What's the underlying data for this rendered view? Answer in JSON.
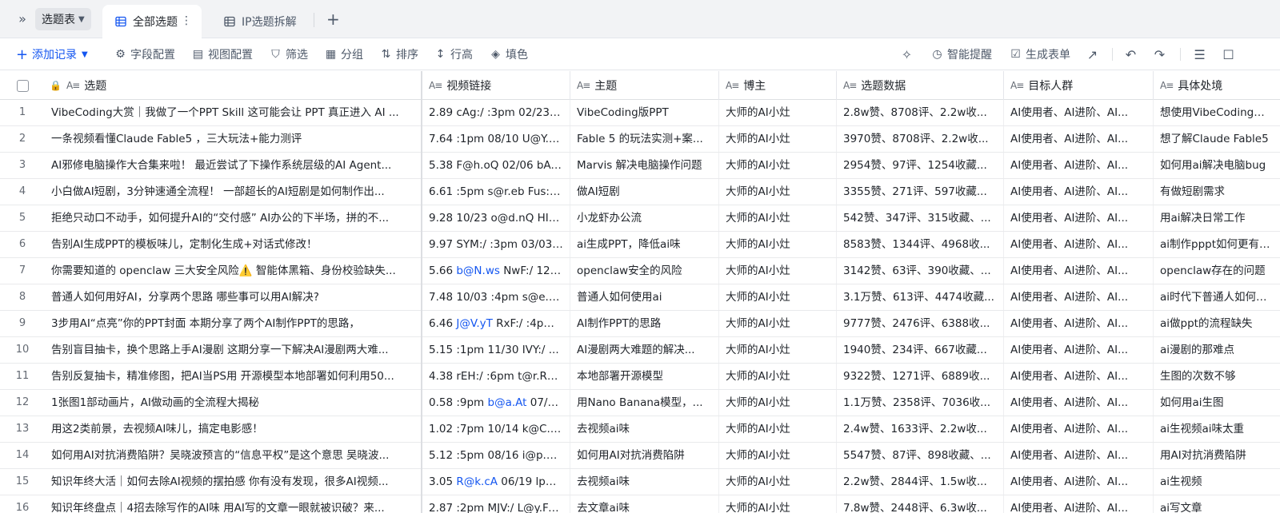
{
  "tabbar": {
    "table_name": "选题表",
    "tabs": [
      {
        "label": "全部选题",
        "active": true
      },
      {
        "label": "IP选题拆解",
        "active": false
      }
    ]
  },
  "toolbar": {
    "add_record": "添加记录",
    "field_config": "字段配置",
    "view_config": "视图配置",
    "filter": "筛选",
    "group": "分组",
    "sort": "排序",
    "row_height": "行高",
    "fill": "填色",
    "smart_remind": "智能提醒",
    "generate_form": "生成表单"
  },
  "columns": [
    "选题",
    "视频链接",
    "主题",
    "博主",
    "选题数据",
    "目标人群",
    "具体处境"
  ],
  "rows": [
    {
      "n": "1",
      "topic": "VibeCoding大赏｜我做了一个PPT Skill 这可能会让 PPT 真正进入 AI ...",
      "link_pre": "2.89 cAg:/ :3pm 02/23 ...",
      "link_hl": "",
      "link_post": "",
      "theme": "VibeCoding版PPT",
      "blogger": "大师的AI小灶",
      "stats": "2.8w赞、8708评、2.2w收...",
      "audience": "AI使用者、AI进阶、AI...",
      "situation": "想使用VibeCoding做一..."
    },
    {
      "n": "2",
      "topic": "一条视频看懂Claude Fable5 ，三大玩法+能力测评",
      "link_pre": "7.64 :1pm 08/10 U@Y.zt...",
      "link_hl": "",
      "link_post": "",
      "theme": "Fable 5 的玩法实测+案...",
      "blogger": "大师的AI小灶",
      "stats": "3970赞、8708评、2.2w收...",
      "audience": "AI使用者、AI进阶、AI...",
      "situation": "想了解Claude Fable5"
    },
    {
      "n": "3",
      "topic": "AI邪修电脑操作大合集来啦！ 最近尝试了下操作系统层级的AI Agent...",
      "link_pre": "5.38 F@h.oQ 02/06 bAt...",
      "link_hl": "",
      "link_post": "",
      "theme": "Marvis 解决电脑操作问题",
      "blogger": "大师的AI小灶",
      "stats": "2954赞、97评、1254收藏...",
      "audience": "AI使用者、AI进阶、AI...",
      "situation": "如何用ai解决电脑bug"
    },
    {
      "n": "4",
      "topic": "小白做AI短剧，3分钟速通全流程！ 一部超长的AI短剧是如何制作出...",
      "link_pre": "6.61 :5pm s@r.eb Fus:/ ...",
      "link_hl": "",
      "link_post": "",
      "theme": "做AI短剧",
      "blogger": "大师的AI小灶",
      "stats": "3355赞、271评、597收藏...",
      "audience": "AI使用者、AI进阶、AI...",
      "situation": "有做短剧需求"
    },
    {
      "n": "5",
      "topic": "拒绝只动口不动手，如何提升AI的“交付感” AI办公的下半场，拼的不...",
      "link_pre": "9.28 10/23 o@d.nQ HIv...",
      "link_hl": "",
      "link_post": "",
      "theme": "小龙虾办公流",
      "blogger": "大师的AI小灶",
      "stats": "542赞、347评、315收藏、...",
      "audience": "AI使用者、AI进阶、AI...",
      "situation": "用ai解决日常工作"
    },
    {
      "n": "6",
      "topic": "告别AI生成PPT的模板味儿，定制化生成+对话式修改！",
      "link_pre": "9.97 SYM:/ :3pm 03/03 ...",
      "link_hl": "",
      "link_post": "",
      "theme": "ai生成PPT，降低ai味",
      "blogger": "大师的AI小灶",
      "stats": "8583赞、1344评、4968收...",
      "audience": "AI使用者、AI进阶、AI...",
      "situation": "ai制作pppt如何更有“人味”"
    },
    {
      "n": "7",
      "topic": "你需要知道的 openclaw 三大安全风险⚠️ 智能体黑箱、身份校验缺失...",
      "link_pre": "5.66 ",
      "link_hl": "b@N.ws",
      "link_post": " NwF:/ 12/...",
      "theme": "openclaw安全的风险",
      "blogger": "大师的AI小灶",
      "stats": "3142赞、63评、390收藏、...",
      "audience": "AI使用者、AI进阶、AI...",
      "situation": "openclaw存在的问题"
    },
    {
      "n": "8",
      "topic": "普通人如何用好AI，分享两个思路 哪些事可以用AI解决?",
      "link_pre": "7.48 10/03 :4pm s@e.O...",
      "link_hl": "",
      "link_post": "",
      "theme": "普通人如何使用ai",
      "blogger": "大师的AI小灶",
      "stats": "3.1万赞、613评、4474收藏...",
      "audience": "AI使用者、AI进阶、AI...",
      "situation": "ai时代下普通人如何用ai"
    },
    {
      "n": "9",
      "topic": "3步用AI“点亮”你的PPT封面 本期分享了两个AI制作PPT的思路，",
      "link_pre": "6.46 ",
      "link_hl": "J@V.yT",
      "link_post": " RxF:/ :4pm...",
      "theme": "AI制作PPT的思路",
      "blogger": "大师的AI小灶",
      "stats": "9777赞、2476评、6388收...",
      "audience": "AI使用者、AI进阶、AI...",
      "situation": "ai做ppt的流程缺失"
    },
    {
      "n": "10",
      "topic": "告别盲目抽卡，换个思路上手AI漫剧 这期分享一下解决AI漫剧两大难...",
      "link_pre": "5.15 :1pm 11/30 IVY:/ ...",
      "link_hl": "",
      "link_post": "",
      "theme": "AI漫剧两大难题的解决...",
      "blogger": "大师的AI小灶",
      "stats": "1940赞、234评、667收藏...",
      "audience": "AI使用者、AI进阶、AI...",
      "situation": "ai漫剧的那难点"
    },
    {
      "n": "11",
      "topic": "告别反复抽卡，精准修图，把AI当PS用 开源模型本地部署如何利用50...",
      "link_pre": "4.38 rEH:/ :6pm t@r.RX ...",
      "link_hl": "",
      "link_post": "",
      "theme": "本地部署开源模型",
      "blogger": "大师的AI小灶",
      "stats": "9322赞、1271评、6889收...",
      "audience": "AI使用者、AI进阶、AI...",
      "situation": "生图的次数不够"
    },
    {
      "n": "12",
      "topic": "1张图1部动画片，AI做动画的全流程大揭秘",
      "link_pre": "0.58 :9pm ",
      "link_hl": "b@a.At",
      "link_post": " 07/2...",
      "theme": "用Nano Banana模型，...",
      "blogger": "大师的AI小灶",
      "stats": "1.1万赞、2358评、7036收...",
      "audience": "AI使用者、AI进阶、AI...",
      "situation": "如何用ai生图"
    },
    {
      "n": "13",
      "topic": "用这2类前景，去视频AI味儿，搞定电影感！",
      "link_pre": "1.02 :7pm 10/14 k@C.H...",
      "link_hl": "",
      "link_post": "",
      "theme": "去视频ai味",
      "blogger": "大师的AI小灶",
      "stats": "2.4w赞、1633评、2.2w收...",
      "audience": "AI使用者、AI进阶、AI...",
      "situation": "ai生视频ai味太重"
    },
    {
      "n": "14",
      "topic": "如何用AI对抗消费陷阱？吴晓波预言的“信息平权”是这个意思 吴晓波...",
      "link_pre": "5.12 :5pm 08/16 i@p.Q...",
      "link_hl": "",
      "link_post": "",
      "theme": "如何用AI对抗消费陷阱",
      "blogger": "大师的AI小灶",
      "stats": "5547赞、87评、898收藏、...",
      "audience": "AI使用者、AI进阶、AI...",
      "situation": "用AI对抗消费陷阱"
    },
    {
      "n": "15",
      "topic": "知识年终大活｜如何去除AI视频的摆拍感 你有没有发现，很多AI视频...",
      "link_pre": "3.05 ",
      "link_hl": "R@k.cA",
      "link_post": " 06/19 lpQ:...",
      "theme": "去视频ai味",
      "blogger": "大师的AI小灶",
      "stats": "2.2w赞、2844评、1.5w收...",
      "audience": "AI使用者、AI进阶、AI...",
      "situation": "ai生视频"
    },
    {
      "n": "16",
      "topic": "知识年终盘点｜4招去除写作的AI味 用AI写的文章一眼就被识破？来...",
      "link_pre": "2.87 :2pm MJV:/ L@y.Fu...",
      "link_hl": "",
      "link_post": "",
      "theme": "去文章ai味",
      "blogger": "大师的AI小灶",
      "stats": "7.8w赞、2448评、6.3w收...",
      "audience": "AI使用者、AI进阶、AI...",
      "situation": "ai写文章"
    }
  ]
}
